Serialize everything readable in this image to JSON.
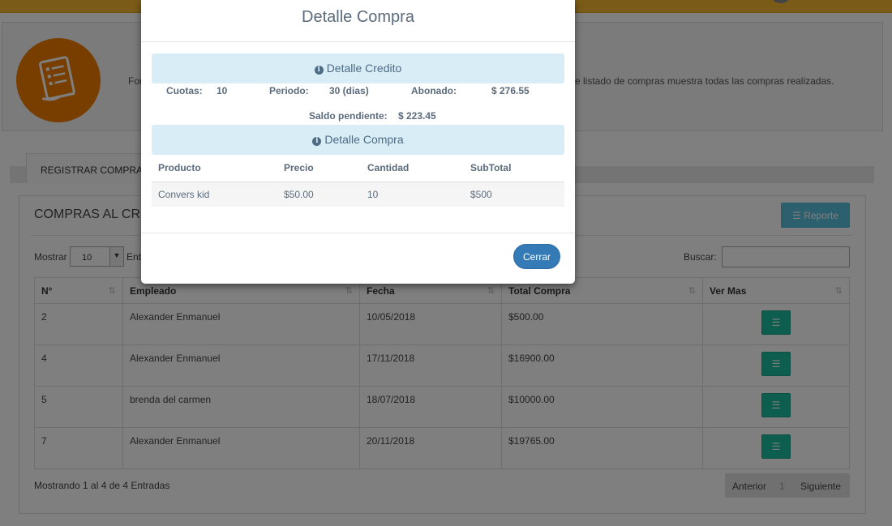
{
  "page": {
    "header": {
      "text_left": "For",
      "text_right": "e listado de compras muestra todas las compras realizadas."
    },
    "tab_active": "REGISTRAR COMPRA",
    "content_title": "COMPRAS AL CR",
    "reporte_label": "Reporte",
    "show_label": "Mostrar",
    "show_value": "10",
    "show_suffix": "Ent",
    "search_label": "Buscar:",
    "table": {
      "headers": [
        "N°",
        "Empleado",
        "Fecha",
        "Total Compra",
        "Ver Mas"
      ],
      "rows": [
        {
          "num": "2",
          "empleado": "Alexander Enmanuel",
          "fecha": "10/05/2018",
          "total": "$500.00"
        },
        {
          "num": "4",
          "empleado": "Alexander Enmanuel",
          "fecha": "17/11/2018",
          "total": "$16900.00"
        },
        {
          "num": "5",
          "empleado": "brenda del carmen",
          "fecha": "18/07/2018",
          "total": "$10000.00"
        },
        {
          "num": "7",
          "empleado": "Alexander Enmanuel",
          "fecha": "20/11/2018",
          "total": "$19765.00"
        }
      ]
    },
    "footer_info": "Mostrando 1 al 4 de 4 Entradas",
    "pager": {
      "prev": "Anterior",
      "page": "1",
      "next": "Siguiente"
    }
  },
  "modal": {
    "title": "Detalle Compra",
    "credit_section_title": "Detalle Credito",
    "cuotas_label": "Cuotas:",
    "cuotas_value": "10",
    "periodo_label": "Periodo:",
    "periodo_value": "30 (dias)",
    "abonado_label": "Abonado:",
    "abonado_value": "$ 276.55",
    "saldo_label": "Saldo pendiente:",
    "saldo_value": "$ 223.45",
    "purchase_section_title": "Detalle Compra",
    "detail_table": {
      "headers": [
        "Producto",
        "Precio",
        "Cantidad",
        "SubTotal"
      ],
      "rows": [
        {
          "producto": "Convers kid",
          "precio": "$50.00",
          "cantidad": "10",
          "subtotal": "$500"
        }
      ]
    },
    "close_label": "Cerrar"
  },
  "colors": {
    "topbar": "#f5b72e",
    "header_circle": "#f07d00",
    "reporte_button": "#5bc0de",
    "action_button": "#1abc9c",
    "close_button": "#337ab7",
    "info_banner": "#d9edf7"
  },
  "icons": {
    "header": "document-list-icon",
    "reporte": "list-icon",
    "action": "list-icon",
    "info": "info-circle-icon",
    "sort": "sort-icon"
  }
}
